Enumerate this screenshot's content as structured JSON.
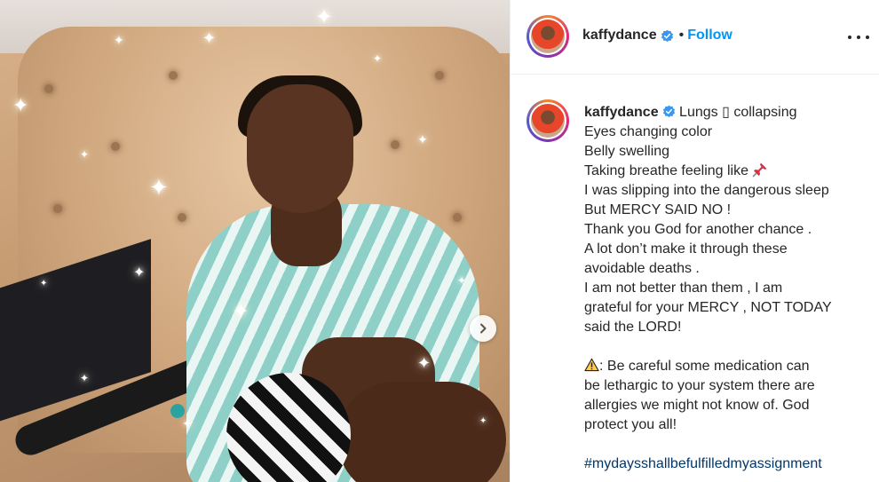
{
  "post": {
    "username": "kaffydance",
    "follow_separator": "•",
    "follow_label": "Follow",
    "more_icon": "more-horizontal-icon",
    "verified_color": "#3897f0",
    "follow_color": "#0095f6"
  },
  "caption": {
    "username": "kaffydance",
    "first_line": "Lungs ▯ collapsing",
    "lines": [
      "Eyes changing color",
      "Belly swelling",
      "Taking breathe feeling like"
    ],
    "lines2": [
      "I was slipping into the dangerous sleep",
      "But MERCY SAID NO !",
      "Thank you God for another chance .",
      "A lot don’t make it through these",
      "avoidable deaths .",
      "I am not better than them , I am",
      "grateful for your MERCY , NOT TODAY",
      "said the LORD!"
    ],
    "warning_lines": [
      ": Be careful some medication can",
      "be lethargic to your system there are",
      "allergies we might not know of. God",
      "protect you all!"
    ],
    "hashtag": "#mydaysshallbefulfilledmyassignment"
  },
  "media": {
    "next_icon": "chevron-right-icon"
  }
}
